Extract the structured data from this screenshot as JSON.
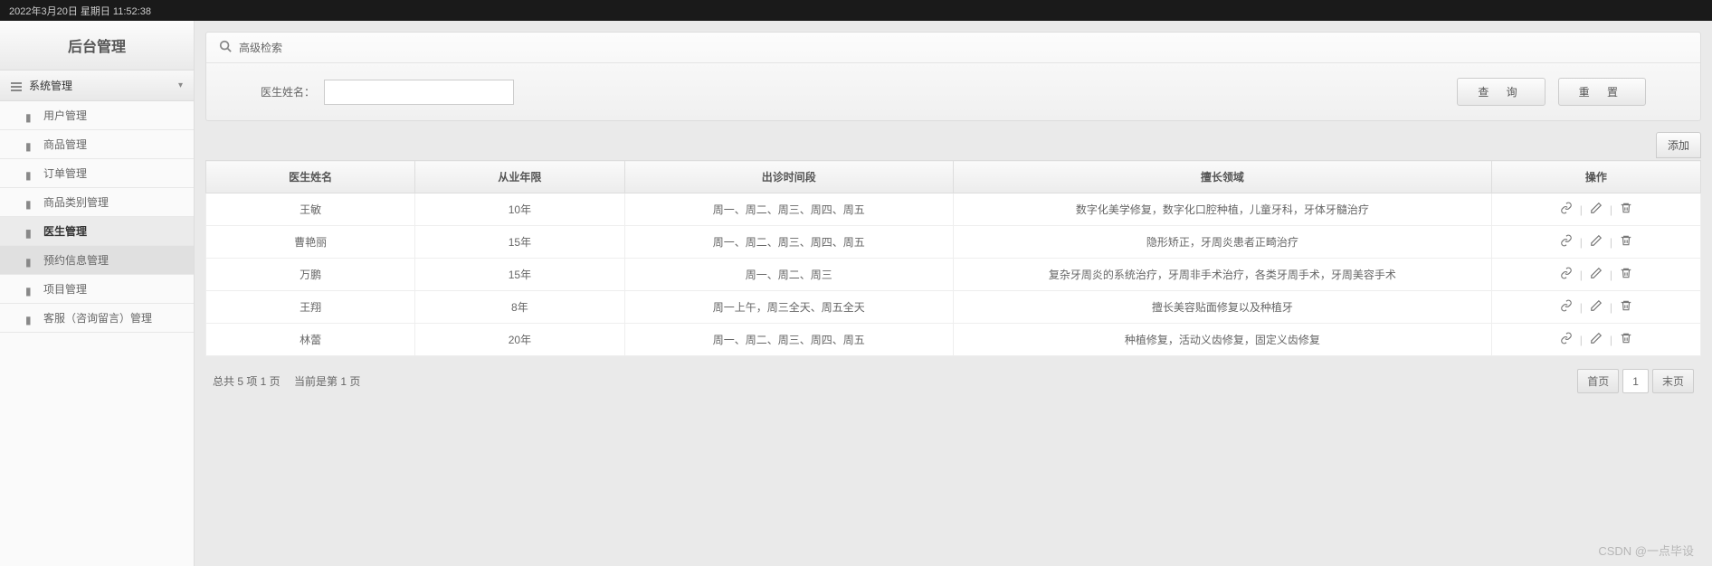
{
  "topbar": {
    "datetime": "2022年3月20日 星期日 11:52:38"
  },
  "sidebar": {
    "title": "后台管理",
    "group_label": "系统管理",
    "items": [
      {
        "label": "用户管理"
      },
      {
        "label": "商品管理"
      },
      {
        "label": "订单管理"
      },
      {
        "label": "商品类别管理"
      },
      {
        "label": "医生管理"
      },
      {
        "label": "预约信息管理"
      },
      {
        "label": "项目管理"
      },
      {
        "label": "客服（咨询留言）管理"
      }
    ]
  },
  "search": {
    "header": "高级检索",
    "label": "医生姓名：",
    "input_value": "",
    "btn_query": "查 询",
    "btn_reset": "重 置"
  },
  "toolbar": {
    "add_label": "添加"
  },
  "table": {
    "headers": [
      "医生姓名",
      "从业年限",
      "出诊时间段",
      "擅长领域",
      "操作"
    ],
    "rows": [
      {
        "name": "王敏",
        "years": "10年",
        "schedule": "周一、周二、周三、周四、周五",
        "specialty": "数字化美学修复，数字化口腔种植，儿童牙科，牙体牙髓治疗"
      },
      {
        "name": "曹艳丽",
        "years": "15年",
        "schedule": "周一、周二、周三、周四、周五",
        "specialty": "隐形矫正，牙周炎患者正畸治疗"
      },
      {
        "name": "万鹏",
        "years": "15年",
        "schedule": "周一、周二、周三",
        "specialty": "复杂牙周炎的系统治疗，牙周非手术治疗，各类牙周手术，牙周美容手术"
      },
      {
        "name": "王翔",
        "years": "8年",
        "schedule": "周一上午，周三全天、周五全天",
        "specialty": "擅长美容贴面修复以及种植牙"
      },
      {
        "name": "林蕾",
        "years": "20年",
        "schedule": "周一、周二、周三、周四、周五",
        "specialty": "种植修复，活动义齿修复，固定义齿修复"
      }
    ]
  },
  "pager": {
    "info_a": "总共 5 项 1 页",
    "info_b": "当前是第 1 页",
    "first": "首页",
    "page": "1",
    "last": "末页"
  },
  "watermark": "CSDN @一点毕设"
}
